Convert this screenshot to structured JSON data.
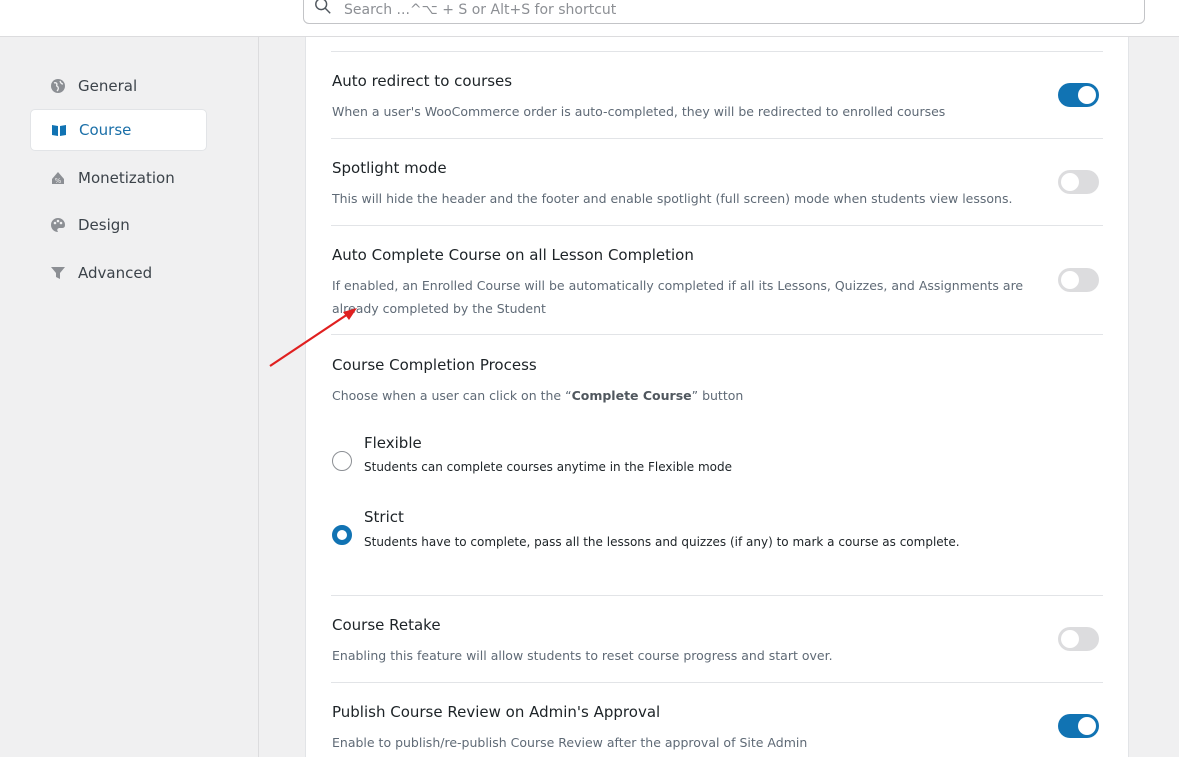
{
  "search": {
    "placeholder": "Search ...^⌥ + S or Alt+S for shortcut"
  },
  "sidebar": {
    "items": [
      {
        "label": "General",
        "icon": "globe-icon"
      },
      {
        "label": "Course",
        "icon": "book-icon",
        "active": true
      },
      {
        "label": "Monetization",
        "icon": "monetization-icon"
      },
      {
        "label": "Design",
        "icon": "palette-icon"
      },
      {
        "label": "Advanced",
        "icon": "filter-icon"
      }
    ]
  },
  "settings": {
    "auto_redirect": {
      "title": "Auto redirect to courses",
      "desc": "When a user's WooCommerce order is auto-completed, they will be redirected to enrolled courses",
      "enabled": true
    },
    "spotlight": {
      "title": "Spotlight mode",
      "desc": "This will hide the header and the footer and enable spotlight (full screen) mode when students view lessons.",
      "enabled": false
    },
    "auto_complete": {
      "title": "Auto Complete Course on all Lesson Completion",
      "desc_line1": "If enabled, an Enrolled Course will be automatically completed if all its Lessons, Quizzes, and Assignments are",
      "desc_line2": "already completed by the Student",
      "enabled": false
    },
    "completion_process": {
      "title": "Course Completion Process",
      "desc_prefix": "Choose when a user can click on the “",
      "desc_bold": "Complete Course",
      "desc_suffix": "” button",
      "options": [
        {
          "label": "Flexible",
          "desc": "Students can complete courses anytime in the Flexible mode",
          "selected": false
        },
        {
          "label": "Strict",
          "desc": "Students have to complete, pass all the lessons and quizzes (if any) to mark a course as complete.",
          "selected": true
        }
      ]
    },
    "retake": {
      "title": "Course Retake",
      "desc": "Enabling this feature will allow students to reset course progress and start over.",
      "enabled": false
    },
    "review_approval": {
      "title": "Publish Course Review on Admin's Approval",
      "desc": "Enable to publish/re-publish Course Review after the approval of Site Admin",
      "enabled": true
    }
  },
  "colors": {
    "accent": "#1173b3",
    "annotation_arrow": "#e02020"
  }
}
